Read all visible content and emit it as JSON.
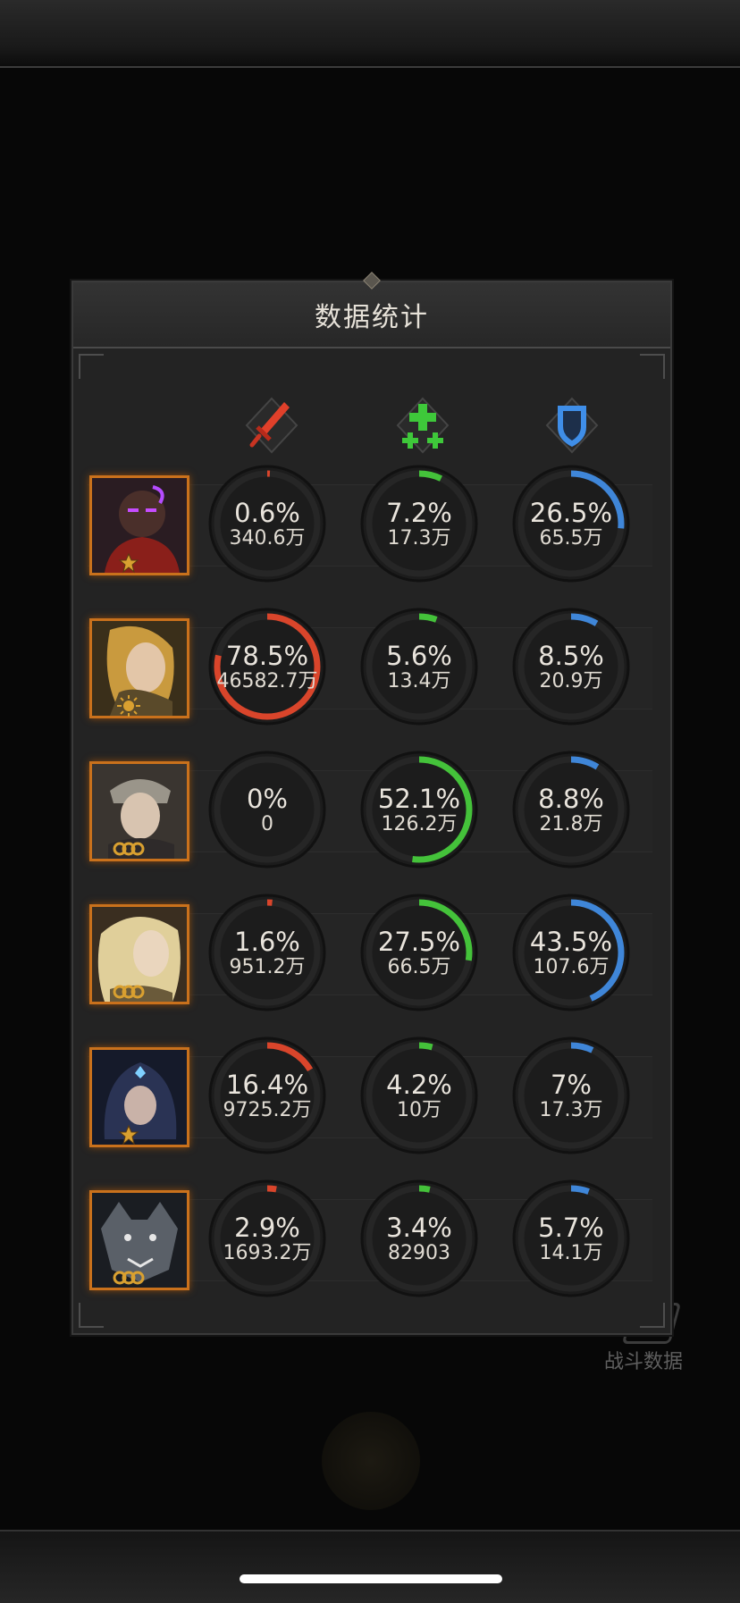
{
  "panel": {
    "title": "数据统计"
  },
  "background": {
    "battle_data_label": "战斗数据"
  },
  "columns": [
    {
      "icon": "sword-icon",
      "color": "#e0402a"
    },
    {
      "icon": "heal-plus-icon",
      "color": "#3ec83a"
    },
    {
      "icon": "shield-icon",
      "color": "#3f8ee8"
    }
  ],
  "colors": {
    "damage": "#d9452b",
    "heal": "#44c23a",
    "tank": "#3f86d8",
    "avatar_border": "#c9711c"
  },
  "heroes": [
    {
      "badge": "star-badge",
      "stats": [
        {
          "percent": "0.6%",
          "value": "340.6万"
        },
        {
          "percent": "7.2%",
          "value": "17.3万"
        },
        {
          "percent": "26.5%",
          "value": "65.5万"
        }
      ]
    },
    {
      "badge": "sun-badge",
      "stats": [
        {
          "percent": "78.5%",
          "value": "46582.7万"
        },
        {
          "percent": "5.6%",
          "value": "13.4万"
        },
        {
          "percent": "8.5%",
          "value": "20.9万"
        }
      ]
    },
    {
      "badge": "rings-badge",
      "stats": [
        {
          "percent": "0%",
          "value": "0"
        },
        {
          "percent": "52.1%",
          "value": "126.2万"
        },
        {
          "percent": "8.8%",
          "value": "21.8万"
        }
      ]
    },
    {
      "badge": "rings-badge",
      "stats": [
        {
          "percent": "1.6%",
          "value": "951.2万"
        },
        {
          "percent": "27.5%",
          "value": "66.5万"
        },
        {
          "percent": "43.5%",
          "value": "107.6万"
        }
      ]
    },
    {
      "badge": "star-badge",
      "stats": [
        {
          "percent": "16.4%",
          "value": "9725.2万"
        },
        {
          "percent": "4.2%",
          "value": "10万"
        },
        {
          "percent": "7%",
          "value": "17.3万"
        }
      ]
    },
    {
      "badge": "rings-badge",
      "stats": [
        {
          "percent": "2.9%",
          "value": "1693.2万"
        },
        {
          "percent": "3.4%",
          "value": "82903"
        },
        {
          "percent": "5.7%",
          "value": "14.1万"
        }
      ]
    }
  ]
}
